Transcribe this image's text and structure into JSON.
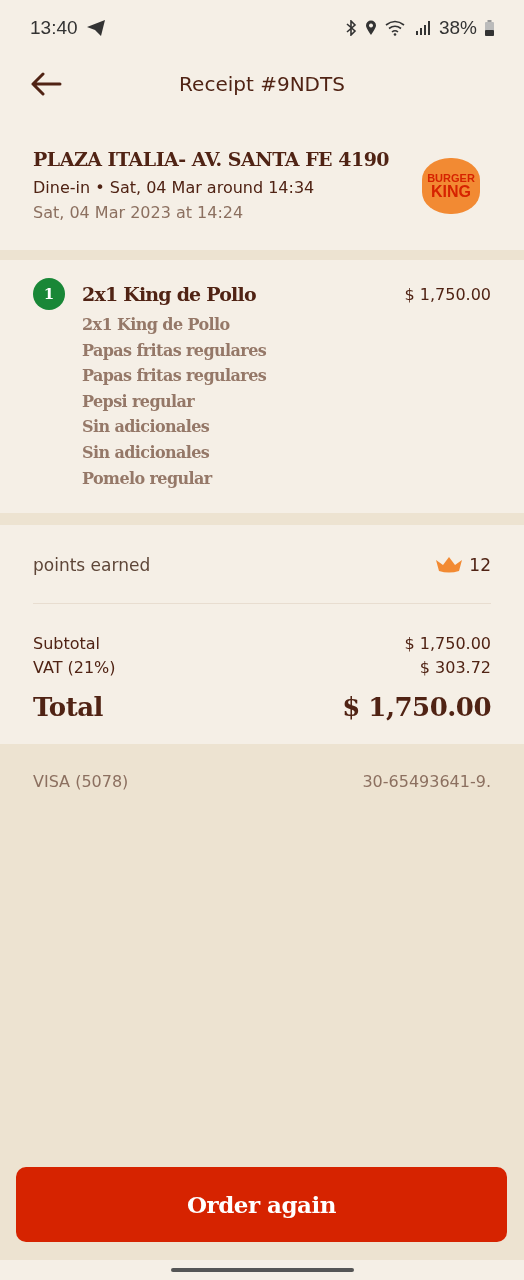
{
  "status_bar": {
    "time": "13:40",
    "battery": "38%"
  },
  "header": {
    "title": "Receipt #9NDTS"
  },
  "store": {
    "name": "PLAZA ITALIA- AV. SANTA FE 4190",
    "order_info": "Dine-in • Sat, 04 Mar around 14:34",
    "date": "Sat, 04 Mar 2023 at 14:24",
    "logo_lines": [
      "BURGER",
      "KING"
    ]
  },
  "items": [
    {
      "quantity": "1",
      "name": "2x1 King de Pollo",
      "price": "$ 1,750.00",
      "details": [
        "2x1 King de Pollo",
        "Papas fritas regulares",
        "Papas fritas regulares",
        "Pepsi regular",
        "Sin adicionales",
        "Sin adicionales",
        "Pomelo regular"
      ]
    }
  ],
  "points": {
    "label": "points earned",
    "value": "12"
  },
  "summary": [
    {
      "label": "Subtotal",
      "value": "$ 1,750.00"
    },
    {
      "label": "VAT (21%)",
      "value": "$ 303.72"
    }
  ],
  "total": {
    "label": "Total",
    "value": "$ 1,750.00"
  },
  "payment": {
    "method": "VISA (5078)",
    "reference": "30-65493641-9."
  },
  "order_again_button": "Order again"
}
